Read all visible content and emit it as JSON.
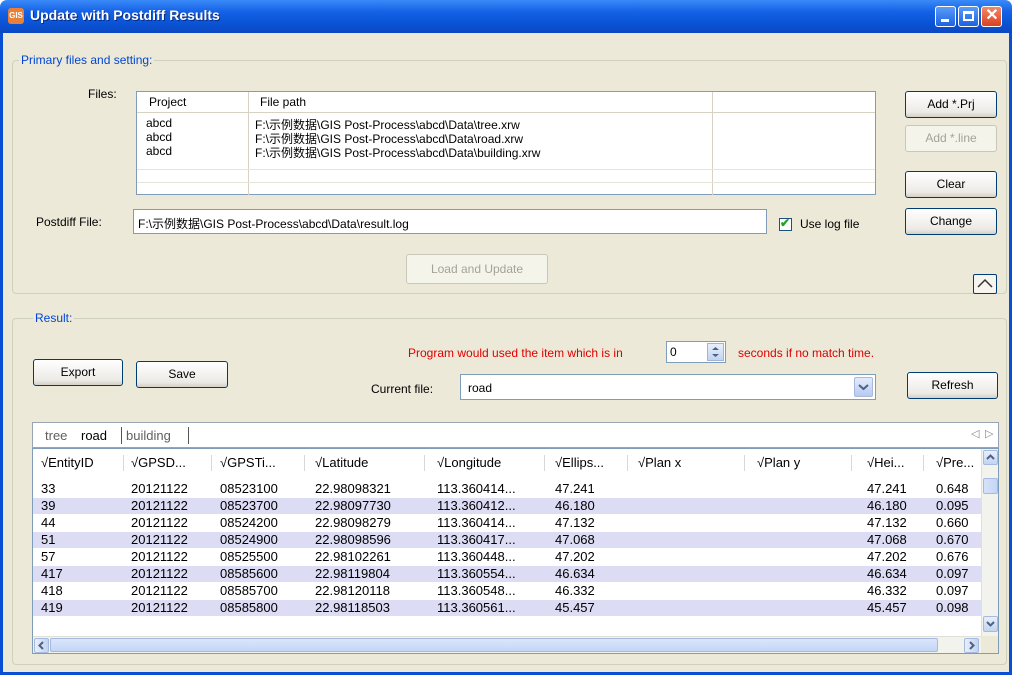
{
  "window": {
    "title": "Update with Postdiff Results",
    "app_icon_text": "GIS"
  },
  "primary": {
    "group_title": "Primary files and setting:",
    "files_label": "Files:",
    "columns": [
      "Project",
      "File path"
    ],
    "rows": [
      {
        "project": "abcd",
        "path": "F:\\示例数据\\GIS Post-Process\\abcd\\Data\\tree.xrw"
      },
      {
        "project": "abcd",
        "path": "F:\\示例数据\\GIS Post-Process\\abcd\\Data\\road.xrw"
      },
      {
        "project": "abcd",
        "path": "F:\\示例数据\\GIS Post-Process\\abcd\\Data\\building.xrw"
      }
    ],
    "buttons": {
      "add_prj": "Add *.Prj",
      "add_line": "Add *.line",
      "clear": "Clear",
      "change": "Change",
      "load_update": "Load and Update"
    },
    "postdiff_label": "Postdiff File:",
    "postdiff_value": "F:\\示例数据\\GIS Post-Process\\abcd\\Data\\result.log",
    "use_log_label": "Use log file",
    "use_log_checked": true
  },
  "result": {
    "group_title": "Result:",
    "export": "Export",
    "save": "Save",
    "program_msg_1": "Program would used the item which is in",
    "seconds_value": "0",
    "program_msg_2": "seconds if no match time.",
    "current_file_label": "Current file:",
    "current_file_value": "road",
    "refresh": "Refresh",
    "tabs": [
      "tree",
      "road",
      "building"
    ],
    "active_tab": "road",
    "columns": [
      "√EntityID",
      "√GPSD...",
      "√GPSTi...",
      "√Latitude",
      "√Longitude",
      "√Ellips...",
      "√Plan x",
      "√Plan y",
      "√Hei...",
      "√Pre..."
    ],
    "rows": [
      [
        "33",
        "20121122",
        "08523100",
        "22.98098321",
        "113.360414...",
        "47.241",
        "",
        "",
        "47.241",
        "0.648"
      ],
      [
        "39",
        "20121122",
        "08523700",
        "22.98097730",
        "113.360412...",
        "46.180",
        "",
        "",
        "46.180",
        "0.095"
      ],
      [
        "44",
        "20121122",
        "08524200",
        "22.98098279",
        "113.360414...",
        "47.132",
        "",
        "",
        "47.132",
        "0.660"
      ],
      [
        "51",
        "20121122",
        "08524900",
        "22.98098596",
        "113.360417...",
        "47.068",
        "",
        "",
        "47.068",
        "0.670"
      ],
      [
        "57",
        "20121122",
        "08525500",
        "22.98102261",
        "113.360448...",
        "47.202",
        "",
        "",
        "47.202",
        "0.676"
      ],
      [
        "417",
        "20121122",
        "08585600",
        "22.98119804",
        "113.360554...",
        "46.634",
        "",
        "",
        "46.634",
        "0.097"
      ],
      [
        "418",
        "20121122",
        "08585700",
        "22.98120118",
        "113.360548...",
        "46.332",
        "",
        "",
        "46.332",
        "0.097"
      ],
      [
        "419",
        "20121122",
        "08585800",
        "22.98118503",
        "113.360561...",
        "45.457",
        "",
        "",
        "45.457",
        "0.098"
      ]
    ]
  }
}
